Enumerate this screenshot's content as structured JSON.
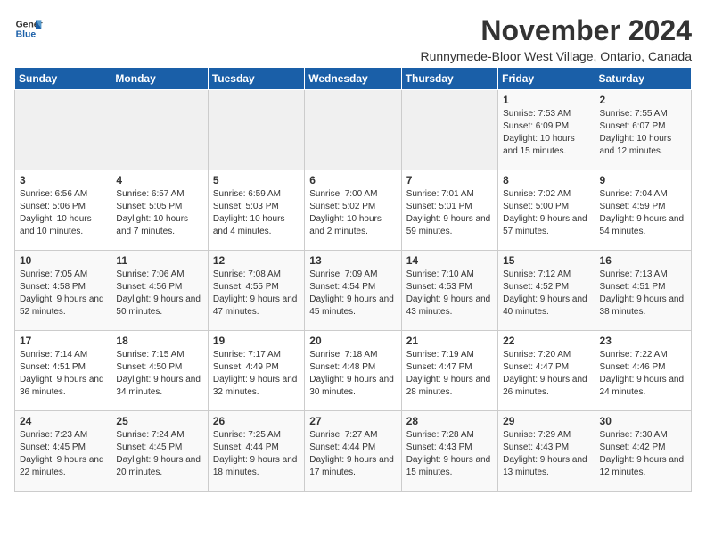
{
  "logo": {
    "line1": "General",
    "line2": "Blue"
  },
  "title": "November 2024",
  "subtitle": "Runnymede-Bloor West Village, Ontario, Canada",
  "weekdays": [
    "Sunday",
    "Monday",
    "Tuesday",
    "Wednesday",
    "Thursday",
    "Friday",
    "Saturday"
  ],
  "weeks": [
    [
      {
        "day": "",
        "info": ""
      },
      {
        "day": "",
        "info": ""
      },
      {
        "day": "",
        "info": ""
      },
      {
        "day": "",
        "info": ""
      },
      {
        "day": "",
        "info": ""
      },
      {
        "day": "1",
        "info": "Sunrise: 7:53 AM\nSunset: 6:09 PM\nDaylight: 10 hours and 15 minutes."
      },
      {
        "day": "2",
        "info": "Sunrise: 7:55 AM\nSunset: 6:07 PM\nDaylight: 10 hours and 12 minutes."
      }
    ],
    [
      {
        "day": "3",
        "info": "Sunrise: 6:56 AM\nSunset: 5:06 PM\nDaylight: 10 hours and 10 minutes."
      },
      {
        "day": "4",
        "info": "Sunrise: 6:57 AM\nSunset: 5:05 PM\nDaylight: 10 hours and 7 minutes."
      },
      {
        "day": "5",
        "info": "Sunrise: 6:59 AM\nSunset: 5:03 PM\nDaylight: 10 hours and 4 minutes."
      },
      {
        "day": "6",
        "info": "Sunrise: 7:00 AM\nSunset: 5:02 PM\nDaylight: 10 hours and 2 minutes."
      },
      {
        "day": "7",
        "info": "Sunrise: 7:01 AM\nSunset: 5:01 PM\nDaylight: 9 hours and 59 minutes."
      },
      {
        "day": "8",
        "info": "Sunrise: 7:02 AM\nSunset: 5:00 PM\nDaylight: 9 hours and 57 minutes."
      },
      {
        "day": "9",
        "info": "Sunrise: 7:04 AM\nSunset: 4:59 PM\nDaylight: 9 hours and 54 minutes."
      }
    ],
    [
      {
        "day": "10",
        "info": "Sunrise: 7:05 AM\nSunset: 4:58 PM\nDaylight: 9 hours and 52 minutes."
      },
      {
        "day": "11",
        "info": "Sunrise: 7:06 AM\nSunset: 4:56 PM\nDaylight: 9 hours and 50 minutes."
      },
      {
        "day": "12",
        "info": "Sunrise: 7:08 AM\nSunset: 4:55 PM\nDaylight: 9 hours and 47 minutes."
      },
      {
        "day": "13",
        "info": "Sunrise: 7:09 AM\nSunset: 4:54 PM\nDaylight: 9 hours and 45 minutes."
      },
      {
        "day": "14",
        "info": "Sunrise: 7:10 AM\nSunset: 4:53 PM\nDaylight: 9 hours and 43 minutes."
      },
      {
        "day": "15",
        "info": "Sunrise: 7:12 AM\nSunset: 4:52 PM\nDaylight: 9 hours and 40 minutes."
      },
      {
        "day": "16",
        "info": "Sunrise: 7:13 AM\nSunset: 4:51 PM\nDaylight: 9 hours and 38 minutes."
      }
    ],
    [
      {
        "day": "17",
        "info": "Sunrise: 7:14 AM\nSunset: 4:51 PM\nDaylight: 9 hours and 36 minutes."
      },
      {
        "day": "18",
        "info": "Sunrise: 7:15 AM\nSunset: 4:50 PM\nDaylight: 9 hours and 34 minutes."
      },
      {
        "day": "19",
        "info": "Sunrise: 7:17 AM\nSunset: 4:49 PM\nDaylight: 9 hours and 32 minutes."
      },
      {
        "day": "20",
        "info": "Sunrise: 7:18 AM\nSunset: 4:48 PM\nDaylight: 9 hours and 30 minutes."
      },
      {
        "day": "21",
        "info": "Sunrise: 7:19 AM\nSunset: 4:47 PM\nDaylight: 9 hours and 28 minutes."
      },
      {
        "day": "22",
        "info": "Sunrise: 7:20 AM\nSunset: 4:47 PM\nDaylight: 9 hours and 26 minutes."
      },
      {
        "day": "23",
        "info": "Sunrise: 7:22 AM\nSunset: 4:46 PM\nDaylight: 9 hours and 24 minutes."
      }
    ],
    [
      {
        "day": "24",
        "info": "Sunrise: 7:23 AM\nSunset: 4:45 PM\nDaylight: 9 hours and 22 minutes."
      },
      {
        "day": "25",
        "info": "Sunrise: 7:24 AM\nSunset: 4:45 PM\nDaylight: 9 hours and 20 minutes."
      },
      {
        "day": "26",
        "info": "Sunrise: 7:25 AM\nSunset: 4:44 PM\nDaylight: 9 hours and 18 minutes."
      },
      {
        "day": "27",
        "info": "Sunrise: 7:27 AM\nSunset: 4:44 PM\nDaylight: 9 hours and 17 minutes."
      },
      {
        "day": "28",
        "info": "Sunrise: 7:28 AM\nSunset: 4:43 PM\nDaylight: 9 hours and 15 minutes."
      },
      {
        "day": "29",
        "info": "Sunrise: 7:29 AM\nSunset: 4:43 PM\nDaylight: 9 hours and 13 minutes."
      },
      {
        "day": "30",
        "info": "Sunrise: 7:30 AM\nSunset: 4:42 PM\nDaylight: 9 hours and 12 minutes."
      }
    ]
  ]
}
